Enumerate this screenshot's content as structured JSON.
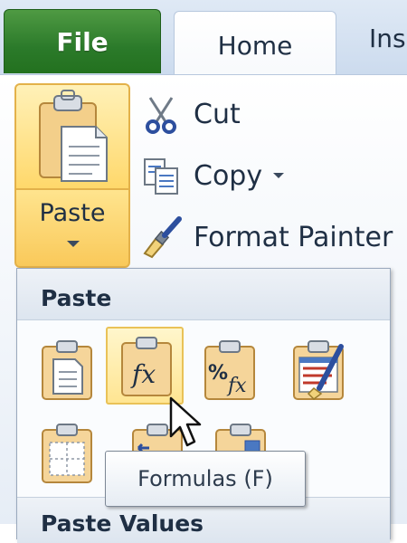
{
  "tabs": {
    "file": "File",
    "home": "Home",
    "insert_partial": "Ins"
  },
  "clipboard": {
    "paste_label": "Paste",
    "cut_label": "Cut",
    "copy_label": "Copy",
    "format_painter_label": "Format Painter"
  },
  "paste_menu": {
    "section1_title": "Paste",
    "section2_title": "Paste Values",
    "options": [
      {
        "icon": "paste-icon",
        "selected": false
      },
      {
        "icon": "paste-formulas-icon",
        "selected": true
      },
      {
        "icon": "paste-formulas-number-formatting-icon",
        "selected": false
      },
      {
        "icon": "keep-source-formatting-icon",
        "selected": false
      },
      {
        "icon": "no-borders-icon",
        "selected": false
      },
      {
        "icon": "keep-source-column-widths-icon",
        "selected": false
      },
      {
        "icon": "transpose-icon",
        "selected": false
      }
    ]
  },
  "tooltip": {
    "text": "Formulas (F)"
  },
  "colors": {
    "file_tab": "#2b7a2a",
    "hover_fill": "#ffe592",
    "hover_border": "#e9c257",
    "clipboard_body": "#f5d59a"
  }
}
